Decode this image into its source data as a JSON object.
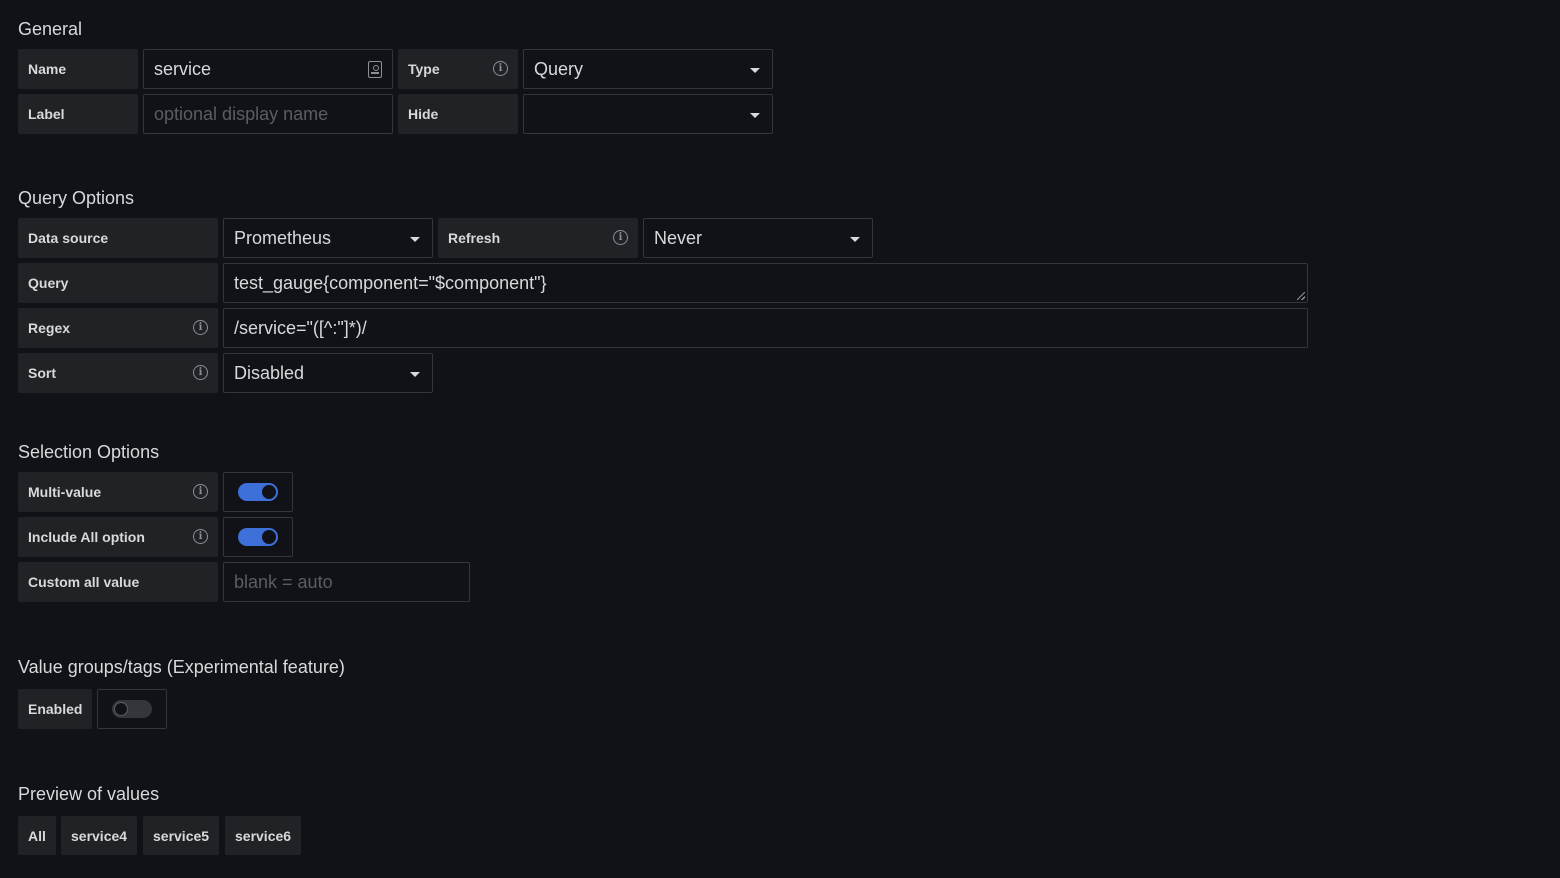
{
  "general": {
    "title": "General",
    "name_label": "Name",
    "name_value": "service",
    "type_label": "Type",
    "type_value": "Query",
    "label_label": "Label",
    "label_placeholder": "optional display name",
    "hide_label": "Hide",
    "hide_value": ""
  },
  "query_options": {
    "title": "Query Options",
    "datasource_label": "Data source",
    "datasource_value": "Prometheus",
    "refresh_label": "Refresh",
    "refresh_value": "Never",
    "query_label": "Query",
    "query_value": "test_gauge{component=\"$component\"}",
    "regex_label": "Regex",
    "regex_value": "/service=\"([^:\"]*)/",
    "sort_label": "Sort",
    "sort_value": "Disabled"
  },
  "selection_options": {
    "title": "Selection Options",
    "multi_value_label": "Multi-value",
    "multi_value_enabled": true,
    "include_all_label": "Include All option",
    "include_all_enabled": true,
    "custom_all_label": "Custom all value",
    "custom_all_placeholder": "blank = auto"
  },
  "value_groups": {
    "title": "Value groups/tags (Experimental feature)",
    "enabled_label": "Enabled",
    "enabled": false
  },
  "preview": {
    "title": "Preview of values",
    "values": [
      "All",
      "service4",
      "service5",
      "service6"
    ]
  },
  "colors": {
    "background": "#111217",
    "label_bg": "#202226",
    "border": "#34363b",
    "accent": "#3d71d9",
    "text": "#d8d9da",
    "placeholder": "#5b5d63"
  },
  "icons": {
    "info": "info-circle-icon",
    "caret": "caret-down-icon",
    "card": "contact-card-icon"
  }
}
